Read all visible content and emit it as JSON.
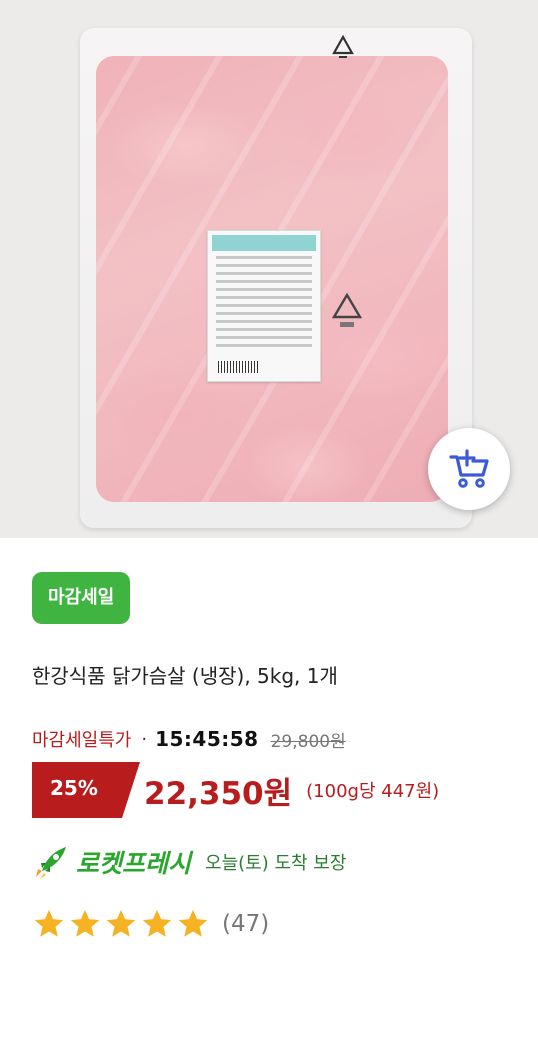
{
  "product_image": {
    "icons": [
      "recycle-icon",
      "recycle-icon",
      "add-to-cart-icon"
    ]
  },
  "badge": {
    "label": "마감세일"
  },
  "product": {
    "title": "한강식품 닭가슴살 (냉장), 5kg, 1개"
  },
  "deal": {
    "label": "마감세일특가",
    "separator": "·",
    "timer": "15:45:58",
    "original_price": "29,800원"
  },
  "price": {
    "discount": "25%",
    "sale_price": "22,350원",
    "unit_price": "(100g당 447원)"
  },
  "delivery": {
    "icon": "rocket-icon",
    "label": "로켓프레시",
    "arrival": "오늘(토) 도착 보장"
  },
  "rating": {
    "stars": 5,
    "max_stars": 5,
    "review_count": "(47)"
  },
  "colors": {
    "badge_green": "#3fb441",
    "price_red": "#b81c1c",
    "rocket_green": "#2aa62e",
    "star_yellow": "#f5b323",
    "cart_blue": "#3a5ad8"
  }
}
